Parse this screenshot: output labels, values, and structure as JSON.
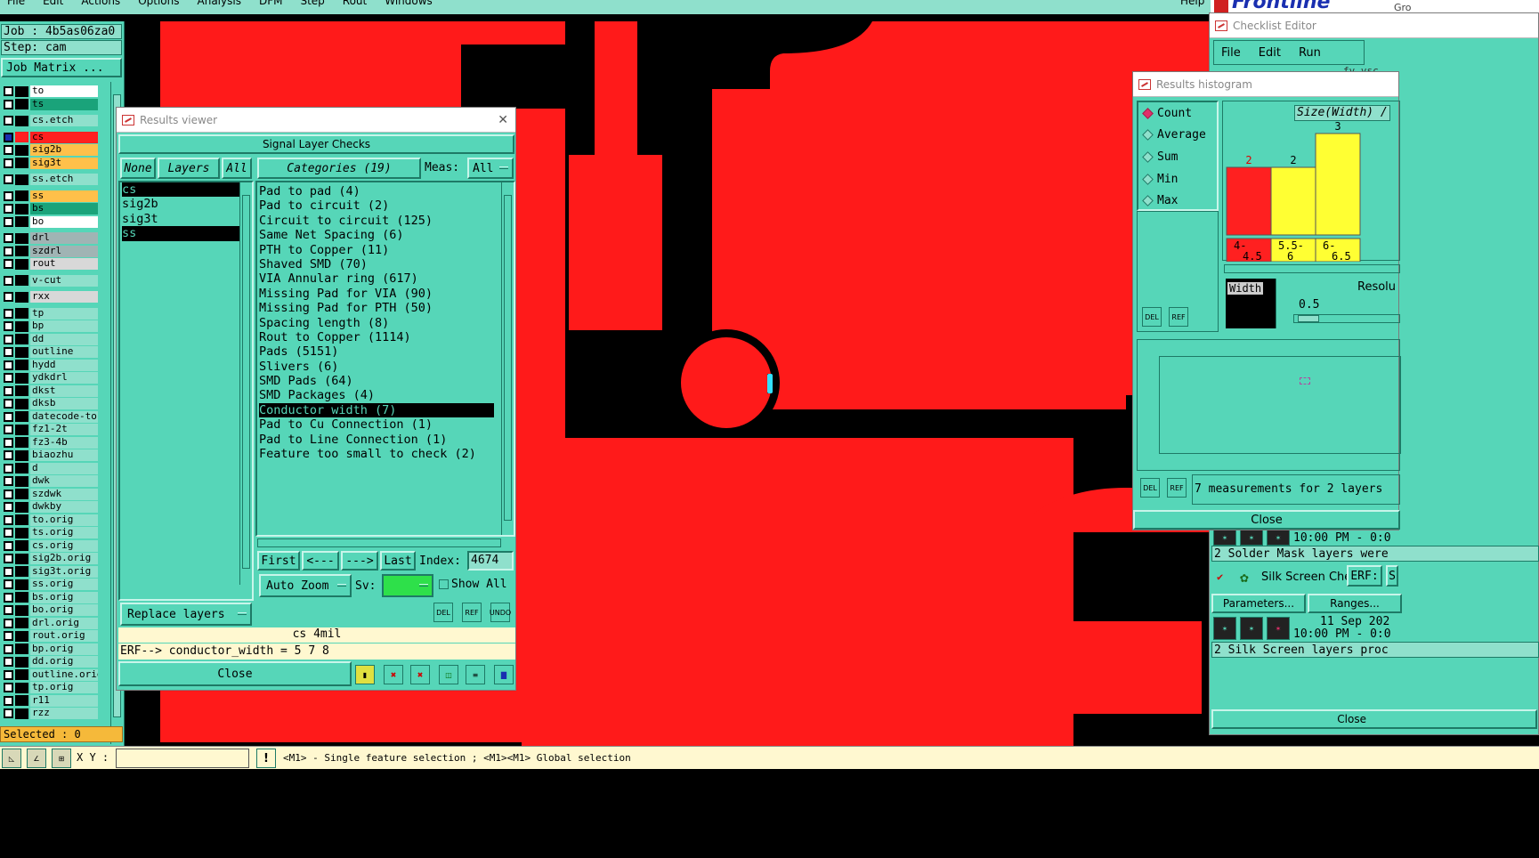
{
  "menubar": {
    "items": [
      "File",
      "Edit",
      "Actions",
      "Options",
      "Analysis",
      "DFM",
      "Step",
      "Rout",
      "Windows"
    ],
    "help": "Help",
    "brand": "Frontline",
    "brand_suffix": "Gro"
  },
  "job_panel": {
    "job_label": "Job : 4b5as06za0",
    "step_label": "Step: cam",
    "matrix_button": "Job Matrix ...",
    "selected_label": "Selected : 0"
  },
  "layers": [
    {
      "name": "to",
      "color": "#ffffff",
      "active": false
    },
    {
      "name": "ts",
      "color": "#1aa37a",
      "active": false
    },
    {
      "name": "cs.etch",
      "color": "#8fe0cc",
      "active": false
    },
    {
      "name": "cs",
      "color": "#ff2020",
      "active": true
    },
    {
      "name": "sig2b",
      "color": "#ffc04a",
      "active": false
    },
    {
      "name": "sig3t",
      "color": "#ffc04a",
      "active": false
    },
    {
      "name": "ss.etch",
      "color": "#8fe0cc",
      "active": false
    },
    {
      "name": "ss",
      "color": "#ffc04a",
      "active": false
    },
    {
      "name": "bs",
      "color": "#1aa37a",
      "active": false
    },
    {
      "name": "bo",
      "color": "#ffffff",
      "active": false
    },
    {
      "name": "drl",
      "color": "#a0b4b4",
      "active": false
    },
    {
      "name": "szdrl",
      "color": "#a0b4b4",
      "active": false
    },
    {
      "name": "rout",
      "color": "#d8d8d8",
      "active": false
    },
    {
      "name": "v-cut",
      "color": "#8fe0cc",
      "active": false
    },
    {
      "name": "rxx",
      "color": "#d8d8d8",
      "active": false
    },
    {
      "name": "tp",
      "color": "#8fe0cc",
      "active": false
    },
    {
      "name": "bp",
      "color": "#8fe0cc",
      "active": false
    },
    {
      "name": "dd",
      "color": "#8fe0cc",
      "active": false
    },
    {
      "name": "outline",
      "color": "#8fe0cc",
      "active": false
    },
    {
      "name": "hydd",
      "color": "#8fe0cc",
      "active": false
    },
    {
      "name": "ydkdrl",
      "color": "#8fe0cc",
      "active": false
    },
    {
      "name": "dkst",
      "color": "#8fe0cc",
      "active": false
    },
    {
      "name": "dksb",
      "color": "#8fe0cc",
      "active": false
    },
    {
      "name": "datecode-to",
      "color": "#8fe0cc",
      "active": false
    },
    {
      "name": "fz1-2t",
      "color": "#8fe0cc",
      "active": false
    },
    {
      "name": "fz3-4b",
      "color": "#8fe0cc",
      "active": false
    },
    {
      "name": "biaozhu",
      "color": "#8fe0cc",
      "active": false
    },
    {
      "name": "d",
      "color": "#8fe0cc",
      "active": false
    },
    {
      "name": "dwk",
      "color": "#8fe0cc",
      "active": false
    },
    {
      "name": "szdwk",
      "color": "#8fe0cc",
      "active": false
    },
    {
      "name": "dwkby",
      "color": "#8fe0cc",
      "active": false
    },
    {
      "name": "to.orig",
      "color": "#8fe0cc",
      "active": false
    },
    {
      "name": "ts.orig",
      "color": "#8fe0cc",
      "active": false
    },
    {
      "name": "cs.orig",
      "color": "#8fe0cc",
      "active": false
    },
    {
      "name": "sig2b.orig",
      "color": "#8fe0cc",
      "active": false
    },
    {
      "name": "sig3t.orig",
      "color": "#8fe0cc",
      "active": false
    },
    {
      "name": "ss.orig",
      "color": "#8fe0cc",
      "active": false
    },
    {
      "name": "bs.orig",
      "color": "#8fe0cc",
      "active": false
    },
    {
      "name": "bo.orig",
      "color": "#8fe0cc",
      "active": false
    },
    {
      "name": "drl.orig",
      "color": "#8fe0cc",
      "active": false
    },
    {
      "name": "rout.orig",
      "color": "#8fe0cc",
      "active": false
    },
    {
      "name": "bp.orig",
      "color": "#8fe0cc",
      "active": false
    },
    {
      "name": "dd.orig",
      "color": "#8fe0cc",
      "active": false
    },
    {
      "name": "outline.orig",
      "color": "#8fe0cc",
      "active": false
    },
    {
      "name": "tp.orig",
      "color": "#8fe0cc",
      "active": false
    },
    {
      "name": "r11",
      "color": "#8fe0cc",
      "active": false
    },
    {
      "name": "rzz",
      "color": "#8fe0cc",
      "active": false
    }
  ],
  "results_viewer": {
    "title": "Results viewer",
    "header": "Signal Layer Checks",
    "btn_none": "None",
    "btn_layers": "Layers",
    "btn_all": "All",
    "categories_label": "Categories (19)",
    "meas_label": "Meas:",
    "meas_value": "All",
    "layer_list": [
      "cs",
      "sig2b",
      "sig3t",
      "ss"
    ],
    "layer_selected": [
      "cs",
      "ss"
    ],
    "categories": [
      "Pad to pad (4)",
      "Pad to circuit (2)",
      "Circuit to circuit (125)",
      "Same Net Spacing (6)",
      "PTH to Copper (11)",
      "Shaved SMD (70)",
      "VIA Annular ring (617)",
      "Missing Pad for VIA (90)",
      "Missing Pad for PTH (50)",
      "Spacing length (8)",
      "Rout to Copper (1114)",
      "Pads (5151)",
      "Slivers (6)",
      "SMD Pads (64)",
      "SMD Packages (4)",
      "Conductor width (7)",
      "Pad to Cu Connection (1)",
      "Pad to Line Connection (1)",
      "Feature too small to check (2)"
    ],
    "category_selected": "Conductor width (7)",
    "btn_first": "First",
    "btn_prev": "<---",
    "btn_next": "--->",
    "btn_last": "Last",
    "index_label": "Index:",
    "index_value": "4674",
    "btn_auto_zoom": "Auto Zoom",
    "sv_label": "Sv:",
    "show_all_label": "Show All",
    "replace_layers": "Replace layers",
    "status_layer": "cs  4mil",
    "erf_line": "ERF--> conductor_width = 5 7 8",
    "close_label": "Close",
    "icon_del": "DEL",
    "icon_ref": "REF",
    "icon_undo": "UNDO"
  },
  "checklist_editor": {
    "title": "Checklist Editor",
    "menu": [
      "File",
      "Edit",
      "Run"
    ],
    "row1_times": "10:00 PM - 0:0",
    "row1_msg": "2 Solder Mask layers were",
    "silk_label": "Silk Screen Che",
    "erf_label": "ERF:",
    "erf_trail": "S",
    "params_button": "Parameters...",
    "ranges_button": "Ranges...",
    "row2_date": "11 Sep 202",
    "row2_time": "10:00 PM - 0:0",
    "row2_msg": "2 Silk Screen layers proc",
    "close_label": "Close",
    "trunc_text": "fv.vsc"
  },
  "histogram": {
    "title": "Results histogram",
    "modes": [
      "Count",
      "Average",
      "Sum",
      "Min",
      "Max"
    ],
    "mode_selected": "Count",
    "chart_title": "Size(Width) /",
    "bars": [
      {
        "label": "4- 4.5",
        "value": 2,
        "color": "#ff2020"
      },
      {
        "label": "5.5- 6",
        "value": 2,
        "color": "#ffff33"
      },
      {
        "label": "6- 6.5",
        "value": 3,
        "color": "#ffff33"
      }
    ],
    "field_label": "Width",
    "resolution_label": "Resolu",
    "resolution_value": "0.5",
    "summary": "7 measurements for 2 layers",
    "close_label": "Close",
    "icon_del": "DEL",
    "icon_ref": "REF"
  },
  "bottom_bar": {
    "xy_label": "X Y :",
    "xy_value": "",
    "bang": "!",
    "hint": "<M1> - Single feature selection ; <M1><M1> Global selection"
  }
}
